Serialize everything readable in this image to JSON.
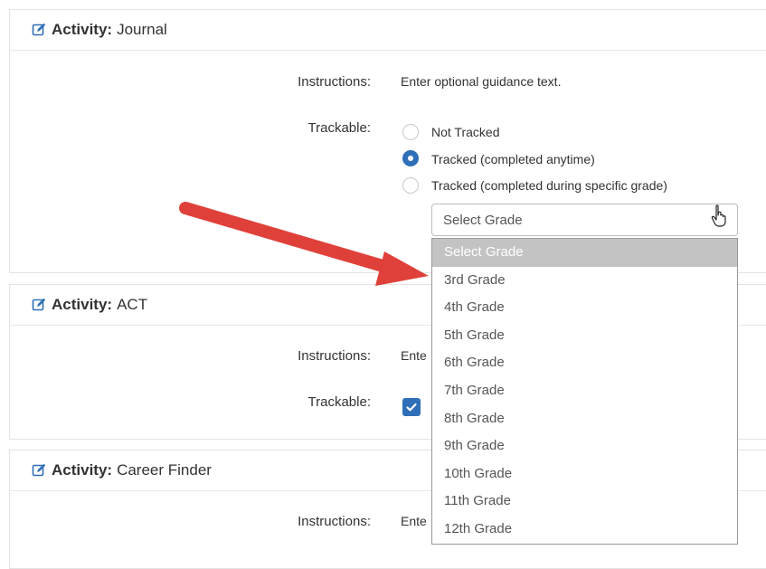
{
  "activities": [
    {
      "prefix": "Activity:",
      "name": "Journal",
      "instructions_label": "Instructions:",
      "instructions_value": "Enter optional guidance text.",
      "trackable_label": "Trackable:",
      "radio_options": [
        {
          "label": "Not Tracked",
          "checked": false
        },
        {
          "label": "Tracked (completed anytime)",
          "checked": true
        },
        {
          "label": "Tracked (completed during specific grade)",
          "checked": false
        }
      ],
      "grade_select": {
        "selected": "Select Grade",
        "options": [
          "Select Grade",
          "3rd Grade",
          "4th Grade",
          "5th Grade",
          "6th Grade",
          "7th Grade",
          "8th Grade",
          "9th Grade",
          "10th Grade",
          "11th Grade",
          "12th Grade"
        ]
      }
    },
    {
      "prefix": "Activity:",
      "name": "ACT",
      "instructions_label": "Instructions:",
      "instructions_value": "Ente",
      "trackable_label": "Trackable:",
      "trackable_checked": true
    },
    {
      "prefix": "Activity:",
      "name": "Career Finder",
      "instructions_label": "Instructions:",
      "instructions_value": "Ente"
    }
  ],
  "colors": {
    "accent": "#2f6fb7",
    "arrow": "#e0403a",
    "selected_option_bg": "#c3c3c3"
  },
  "icons": {
    "edit": "edit-icon",
    "cursor": "hand-pointer-icon"
  }
}
